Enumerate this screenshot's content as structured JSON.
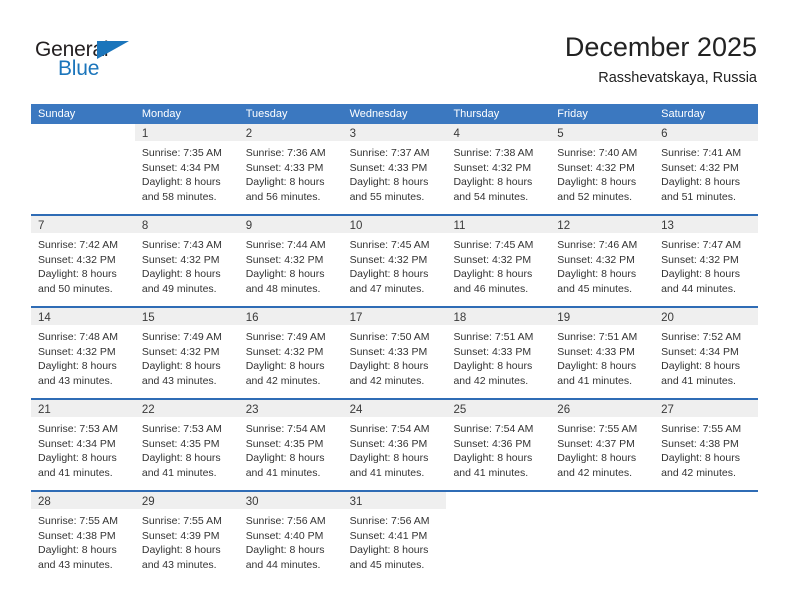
{
  "brand": {
    "name_part1": "General",
    "name_part2": "Blue",
    "accent_color": "#1b75bb",
    "flag_icon": "triangle-flag-icon"
  },
  "header": {
    "title": "December 2025",
    "subtitle": "Rasshevatskaya, Russia"
  },
  "theme": {
    "header_row_bg": "#3b78c0",
    "week_separator": "#2f6cb5",
    "day_band_bg": "#efefef"
  },
  "weekdays": [
    "Sunday",
    "Monday",
    "Tuesday",
    "Wednesday",
    "Thursday",
    "Friday",
    "Saturday"
  ],
  "weeks": [
    [
      {
        "day": "",
        "sunrise": "",
        "sunset": "",
        "daylight_line1": "",
        "daylight_line2": ""
      },
      {
        "day": "1",
        "sunrise": "Sunrise: 7:35 AM",
        "sunset": "Sunset: 4:34 PM",
        "daylight_line1": "Daylight: 8 hours",
        "daylight_line2": "and 58 minutes."
      },
      {
        "day": "2",
        "sunrise": "Sunrise: 7:36 AM",
        "sunset": "Sunset: 4:33 PM",
        "daylight_line1": "Daylight: 8 hours",
        "daylight_line2": "and 56 minutes."
      },
      {
        "day": "3",
        "sunrise": "Sunrise: 7:37 AM",
        "sunset": "Sunset: 4:33 PM",
        "daylight_line1": "Daylight: 8 hours",
        "daylight_line2": "and 55 minutes."
      },
      {
        "day": "4",
        "sunrise": "Sunrise: 7:38 AM",
        "sunset": "Sunset: 4:32 PM",
        "daylight_line1": "Daylight: 8 hours",
        "daylight_line2": "and 54 minutes."
      },
      {
        "day": "5",
        "sunrise": "Sunrise: 7:40 AM",
        "sunset": "Sunset: 4:32 PM",
        "daylight_line1": "Daylight: 8 hours",
        "daylight_line2": "and 52 minutes."
      },
      {
        "day": "6",
        "sunrise": "Sunrise: 7:41 AM",
        "sunset": "Sunset: 4:32 PM",
        "daylight_line1": "Daylight: 8 hours",
        "daylight_line2": "and 51 minutes."
      }
    ],
    [
      {
        "day": "7",
        "sunrise": "Sunrise: 7:42 AM",
        "sunset": "Sunset: 4:32 PM",
        "daylight_line1": "Daylight: 8 hours",
        "daylight_line2": "and 50 minutes."
      },
      {
        "day": "8",
        "sunrise": "Sunrise: 7:43 AM",
        "sunset": "Sunset: 4:32 PM",
        "daylight_line1": "Daylight: 8 hours",
        "daylight_line2": "and 49 minutes."
      },
      {
        "day": "9",
        "sunrise": "Sunrise: 7:44 AM",
        "sunset": "Sunset: 4:32 PM",
        "daylight_line1": "Daylight: 8 hours",
        "daylight_line2": "and 48 minutes."
      },
      {
        "day": "10",
        "sunrise": "Sunrise: 7:45 AM",
        "sunset": "Sunset: 4:32 PM",
        "daylight_line1": "Daylight: 8 hours",
        "daylight_line2": "and 47 minutes."
      },
      {
        "day": "11",
        "sunrise": "Sunrise: 7:45 AM",
        "sunset": "Sunset: 4:32 PM",
        "daylight_line1": "Daylight: 8 hours",
        "daylight_line2": "and 46 minutes."
      },
      {
        "day": "12",
        "sunrise": "Sunrise: 7:46 AM",
        "sunset": "Sunset: 4:32 PM",
        "daylight_line1": "Daylight: 8 hours",
        "daylight_line2": "and 45 minutes."
      },
      {
        "day": "13",
        "sunrise": "Sunrise: 7:47 AM",
        "sunset": "Sunset: 4:32 PM",
        "daylight_line1": "Daylight: 8 hours",
        "daylight_line2": "and 44 minutes."
      }
    ],
    [
      {
        "day": "14",
        "sunrise": "Sunrise: 7:48 AM",
        "sunset": "Sunset: 4:32 PM",
        "daylight_line1": "Daylight: 8 hours",
        "daylight_line2": "and 43 minutes."
      },
      {
        "day": "15",
        "sunrise": "Sunrise: 7:49 AM",
        "sunset": "Sunset: 4:32 PM",
        "daylight_line1": "Daylight: 8 hours",
        "daylight_line2": "and 43 minutes."
      },
      {
        "day": "16",
        "sunrise": "Sunrise: 7:49 AM",
        "sunset": "Sunset: 4:32 PM",
        "daylight_line1": "Daylight: 8 hours",
        "daylight_line2": "and 42 minutes."
      },
      {
        "day": "17",
        "sunrise": "Sunrise: 7:50 AM",
        "sunset": "Sunset: 4:33 PM",
        "daylight_line1": "Daylight: 8 hours",
        "daylight_line2": "and 42 minutes."
      },
      {
        "day": "18",
        "sunrise": "Sunrise: 7:51 AM",
        "sunset": "Sunset: 4:33 PM",
        "daylight_line1": "Daylight: 8 hours",
        "daylight_line2": "and 42 minutes."
      },
      {
        "day": "19",
        "sunrise": "Sunrise: 7:51 AM",
        "sunset": "Sunset: 4:33 PM",
        "daylight_line1": "Daylight: 8 hours",
        "daylight_line2": "and 41 minutes."
      },
      {
        "day": "20",
        "sunrise": "Sunrise: 7:52 AM",
        "sunset": "Sunset: 4:34 PM",
        "daylight_line1": "Daylight: 8 hours",
        "daylight_line2": "and 41 minutes."
      }
    ],
    [
      {
        "day": "21",
        "sunrise": "Sunrise: 7:53 AM",
        "sunset": "Sunset: 4:34 PM",
        "daylight_line1": "Daylight: 8 hours",
        "daylight_line2": "and 41 minutes."
      },
      {
        "day": "22",
        "sunrise": "Sunrise: 7:53 AM",
        "sunset": "Sunset: 4:35 PM",
        "daylight_line1": "Daylight: 8 hours",
        "daylight_line2": "and 41 minutes."
      },
      {
        "day": "23",
        "sunrise": "Sunrise: 7:54 AM",
        "sunset": "Sunset: 4:35 PM",
        "daylight_line1": "Daylight: 8 hours",
        "daylight_line2": "and 41 minutes."
      },
      {
        "day": "24",
        "sunrise": "Sunrise: 7:54 AM",
        "sunset": "Sunset: 4:36 PM",
        "daylight_line1": "Daylight: 8 hours",
        "daylight_line2": "and 41 minutes."
      },
      {
        "day": "25",
        "sunrise": "Sunrise: 7:54 AM",
        "sunset": "Sunset: 4:36 PM",
        "daylight_line1": "Daylight: 8 hours",
        "daylight_line2": "and 41 minutes."
      },
      {
        "day": "26",
        "sunrise": "Sunrise: 7:55 AM",
        "sunset": "Sunset: 4:37 PM",
        "daylight_line1": "Daylight: 8 hours",
        "daylight_line2": "and 42 minutes."
      },
      {
        "day": "27",
        "sunrise": "Sunrise: 7:55 AM",
        "sunset": "Sunset: 4:38 PM",
        "daylight_line1": "Daylight: 8 hours",
        "daylight_line2": "and 42 minutes."
      }
    ],
    [
      {
        "day": "28",
        "sunrise": "Sunrise: 7:55 AM",
        "sunset": "Sunset: 4:38 PM",
        "daylight_line1": "Daylight: 8 hours",
        "daylight_line2": "and 43 minutes."
      },
      {
        "day": "29",
        "sunrise": "Sunrise: 7:55 AM",
        "sunset": "Sunset: 4:39 PM",
        "daylight_line1": "Daylight: 8 hours",
        "daylight_line2": "and 43 minutes."
      },
      {
        "day": "30",
        "sunrise": "Sunrise: 7:56 AM",
        "sunset": "Sunset: 4:40 PM",
        "daylight_line1": "Daylight: 8 hours",
        "daylight_line2": "and 44 minutes."
      },
      {
        "day": "31",
        "sunrise": "Sunrise: 7:56 AM",
        "sunset": "Sunset: 4:41 PM",
        "daylight_line1": "Daylight: 8 hours",
        "daylight_line2": "and 45 minutes."
      },
      {
        "day": "",
        "sunrise": "",
        "sunset": "",
        "daylight_line1": "",
        "daylight_line2": ""
      },
      {
        "day": "",
        "sunrise": "",
        "sunset": "",
        "daylight_line1": "",
        "daylight_line2": ""
      },
      {
        "day": "",
        "sunrise": "",
        "sunset": "",
        "daylight_line1": "",
        "daylight_line2": ""
      }
    ]
  ]
}
